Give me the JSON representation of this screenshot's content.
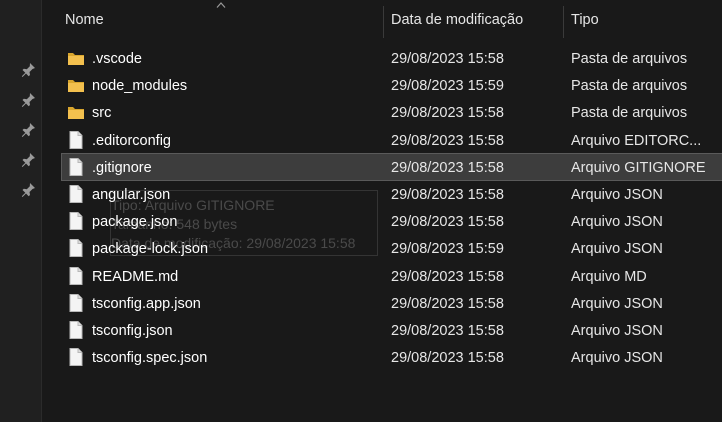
{
  "columns": {
    "name": "Nome",
    "date": "Data de modificação",
    "type": "Tipo"
  },
  "files": [
    {
      "name": ".vscode",
      "date": "29/08/2023 15:58",
      "type": "Pasta de arquivos",
      "icon": "folder-icon"
    },
    {
      "name": "node_modules",
      "date": "29/08/2023 15:59",
      "type": "Pasta de arquivos",
      "icon": "folder-icon"
    },
    {
      "name": "src",
      "date": "29/08/2023 15:58",
      "type": "Pasta de arquivos",
      "icon": "folder-icon"
    },
    {
      "name": ".editorconfig",
      "date": "29/08/2023 15:58",
      "type": "Arquivo EDITORC...",
      "icon": "file-icon"
    },
    {
      "name": ".gitignore",
      "date": "29/08/2023 15:58",
      "type": "Arquivo GITIGNORE",
      "icon": "file-icon",
      "selected": true
    },
    {
      "name": "angular.json",
      "date": "29/08/2023 15:58",
      "type": "Arquivo JSON",
      "icon": "file-icon"
    },
    {
      "name": "package.json",
      "date": "29/08/2023 15:58",
      "type": "Arquivo JSON",
      "icon": "file-icon"
    },
    {
      "name": "package-lock.json",
      "date": "29/08/2023 15:59",
      "type": "Arquivo JSON",
      "icon": "file-icon"
    },
    {
      "name": "README.md",
      "date": "29/08/2023 15:58",
      "type": "Arquivo MD",
      "icon": "file-icon"
    },
    {
      "name": "tsconfig.app.json",
      "date": "29/08/2023 15:58",
      "type": "Arquivo JSON",
      "icon": "file-icon"
    },
    {
      "name": "tsconfig.json",
      "date": "29/08/2023 15:58",
      "type": "Arquivo JSON",
      "icon": "file-icon"
    },
    {
      "name": "tsconfig.spec.json",
      "date": "29/08/2023 15:58",
      "type": "Arquivo JSON",
      "icon": "file-icon"
    }
  ],
  "ghost_tooltip": {
    "line1": "Tipo: Arquivo GITIGNORE",
    "line2": "Tamanho: 548 bytes",
    "line3": "Data de modificação: 29/08/2023 15:58"
  },
  "colors": {
    "background": "#191919",
    "selected_row": "#3d3d3d",
    "folder": "#f3c04e"
  }
}
